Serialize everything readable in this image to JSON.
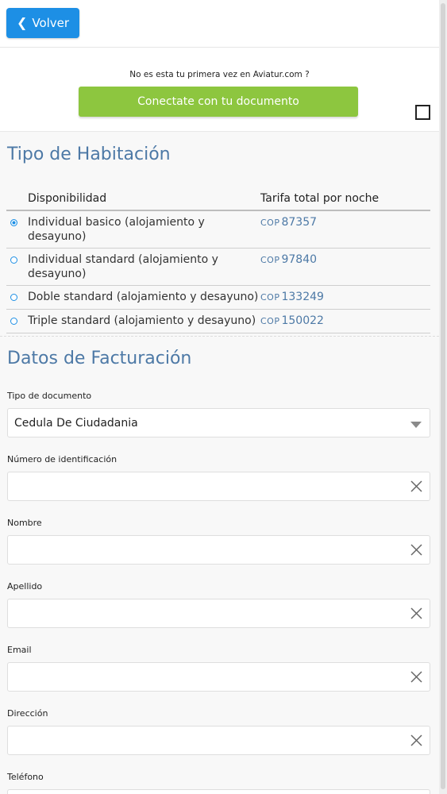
{
  "header": {
    "back_label": "Volver"
  },
  "login": {
    "question": "No es esta tu primera vez en Aviatur.com ?",
    "button_label": "Conectate con tu documento"
  },
  "rooms": {
    "title": "Tipo de Habitación",
    "col_availability": "Disponibilidad",
    "col_rate": "Tarifa total por noche",
    "currency": "COP",
    "items": [
      {
        "name": "Individual basico (alojamiento y desayuno)",
        "price": "87357",
        "selected": true
      },
      {
        "name": "Individual standard (alojamiento y desayuno)",
        "price": "97840",
        "selected": false
      },
      {
        "name": "Doble standard (alojamiento y desayuno)",
        "price": "133249",
        "selected": false
      },
      {
        "name": "Triple standard (alojamiento y desayuno)",
        "price": "150022",
        "selected": false
      }
    ]
  },
  "billing": {
    "title": "Datos de Facturación",
    "doc_type_label": "Tipo de documento",
    "doc_type_value": "Cedula De Ciudadania",
    "id_label": "Número de identificación",
    "name_label": "Nombre",
    "lastname_label": "Apellido",
    "email_label": "Email",
    "address_label": "Dirección",
    "phone_label": "Teléfono"
  },
  "colors": {
    "primary": "#1d8fe5",
    "login_green": "#8dc63f",
    "title_blue": "#4d79a6"
  }
}
